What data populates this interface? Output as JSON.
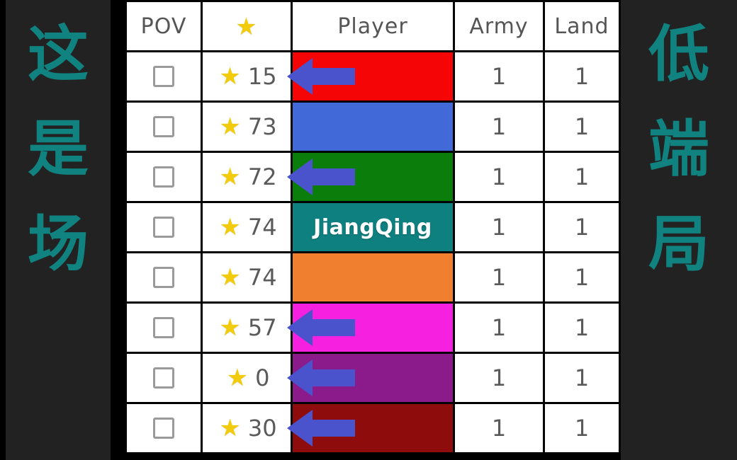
{
  "background": {
    "page_color": "#000000",
    "panel_color": "#222222"
  },
  "left_caption": {
    "chars": [
      "这",
      "是",
      "场"
    ],
    "color": "#10827f"
  },
  "right_caption": {
    "chars": [
      "低",
      "端",
      "局"
    ],
    "color": "#10827f"
  },
  "scoreboard": {
    "columns": [
      {
        "key": "pov",
        "label": "POV"
      },
      {
        "key": "stars",
        "label": "★"
      },
      {
        "key": "player",
        "label": "Player"
      },
      {
        "key": "army",
        "label": "Army"
      },
      {
        "key": "land",
        "label": "Land"
      }
    ],
    "checkbox_state": "unchecked",
    "star_icon": "★",
    "star_color": "#f2cc0c",
    "arrow_color": "#4a52cc",
    "rows": [
      {
        "pov_checked": false,
        "stars": "15",
        "player_name": "",
        "player_color": "#f50505",
        "has_arrow": true,
        "army": "1",
        "land": "1"
      },
      {
        "pov_checked": false,
        "stars": "73",
        "player_name": "",
        "player_color": "#4169d8",
        "has_arrow": false,
        "army": "1",
        "land": "1"
      },
      {
        "pov_checked": false,
        "stars": "72",
        "player_name": "",
        "player_color": "#0a7d0a",
        "has_arrow": true,
        "army": "1",
        "land": "1"
      },
      {
        "pov_checked": false,
        "stars": "74",
        "player_name": "JiangQing",
        "player_color": "#0f8080",
        "has_arrow": false,
        "army": "1",
        "land": "1"
      },
      {
        "pov_checked": false,
        "stars": "74",
        "player_name": "",
        "player_color": "#f08030",
        "has_arrow": false,
        "army": "1",
        "land": "1"
      },
      {
        "pov_checked": false,
        "stars": "57",
        "player_name": "",
        "player_color": "#f520e0",
        "has_arrow": true,
        "army": "1",
        "land": "1"
      },
      {
        "pov_checked": false,
        "stars": "0",
        "player_name": "",
        "player_color": "#8b1a8b",
        "has_arrow": true,
        "army": "1",
        "land": "1"
      },
      {
        "pov_checked": false,
        "stars": "30",
        "player_name": "",
        "player_color": "#8f0c0c",
        "has_arrow": true,
        "army": "1",
        "land": "1"
      }
    ]
  }
}
